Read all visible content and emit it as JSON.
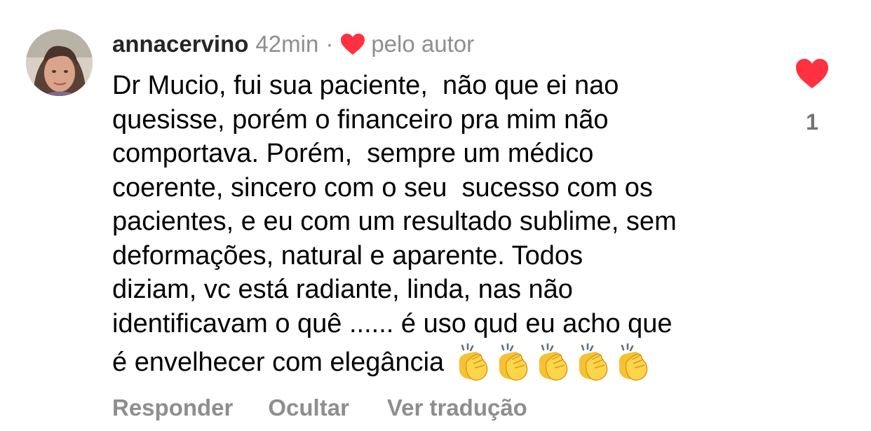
{
  "comment": {
    "username": "annacervino",
    "time": "42min",
    "separator": "·",
    "liked_by_author_label": "pelo autor",
    "body_lines": [
      "Dr Mucio, fui sua paciente,  não que ei nao",
      "quesisse, porém o financeiro pra mim não",
      "comportava. Porém,  sempre um médico",
      "coerente, sincero com o seu  sucesso com os",
      "pacientes, e eu com um resultado sublime, sem",
      "deformações, natural e aparente. Todos",
      "diziam, vc está radiante, linda, nas não",
      "identificavam o quê ...... é uso qud eu acho que"
    ],
    "last_line": "é envelhecer com elegância",
    "emoji": [
      "clapping-hands",
      "clapping-hands",
      "clapping-hands",
      "clapping-hands",
      "clapping-hands"
    ],
    "like_count": "1"
  },
  "actions": {
    "reply": "Responder",
    "hide": "Ocultar",
    "translate": "Ver tradução"
  },
  "icons": {
    "author_heart": "heart-icon",
    "like": "heart-icon"
  },
  "colors": {
    "heart": "#ff3040",
    "muted_text": "#8e8e8e",
    "username": "#262626"
  }
}
